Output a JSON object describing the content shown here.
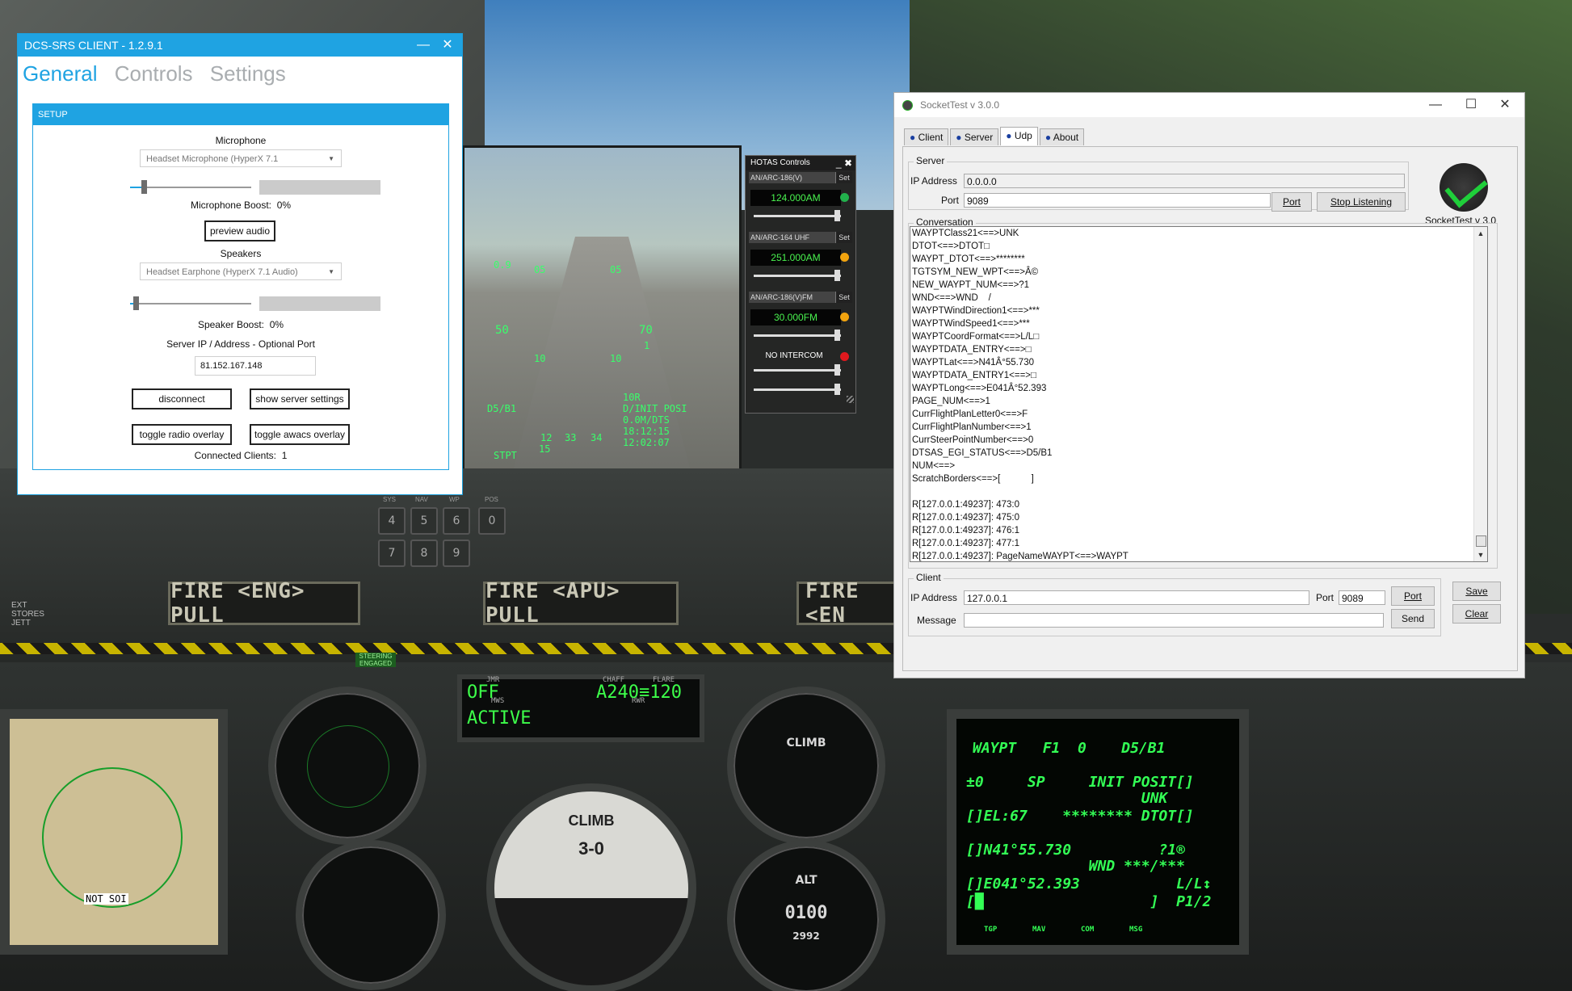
{
  "hud": {
    "left_scale": [
      "0.9",
      "50"
    ],
    "right_scale": [
      "70",
      "1"
    ],
    "ladder": [
      "05",
      "05",
      "10",
      "10"
    ],
    "waypoint": [
      "10R",
      "D/INIT POSI",
      "0.0M/DTS",
      "18:12:15",
      "12:02:07"
    ],
    "mode": "D5/B1",
    "bottom": "STPT",
    "range": [
      "12",
      "33",
      "34"
    ],
    "heading": "15"
  },
  "cockpit": {
    "fire_eng": "FIRE <ENG> PULL",
    "fire_apu": "FIRE <APU> PULL",
    "fire_eng_r": "FIRE <EN",
    "steering": "STEERING ENGAGED",
    "cmsp_l1": "OFF",
    "cmsp_l2": "ACTIVE",
    "cmsp_r": "A240≡120",
    "cmsp_jmr": "JMR",
    "cmsp_chaff": "CHAFF",
    "cmsp_flare": "FLARE",
    "cmsp_mws": "MWS",
    "cmsp_rwr": "RWR",
    "cdu_keys": [
      "4",
      "5",
      "6",
      "0",
      "7",
      "8",
      "9"
    ],
    "adi_label": "CLIMB",
    "adi_value": "3-0",
    "vvi_label": "CLIMB",
    "alt_value": "0100",
    "alt_label": "ALT",
    "alt_sub": "2992",
    "map_label": "NOT SOI",
    "ext_stores": "EXT STORES JETT",
    "cdu_label_a": "SYS",
    "cdu_label_b": "NAV",
    "cdu_label_c": "WP",
    "cdu_label_d": "POS",
    "mfd": {
      "r1": "WAYPT   F1  0    D5/B1",
      "r2": "±0     SP     INIT POSIT[]",
      "r3": "                    UNK",
      "r4": "[]EL:67    ******** DTOT[]",
      "r5": "[]N41°55.730          ?1®",
      "r6": "              WND ***/***",
      "r7": "[]E041°52.393           L/L↕",
      "r8": "[█                   ]  P1/2",
      "osb": [
        "TGP",
        "MAV",
        "COM",
        "MSG"
      ]
    }
  },
  "hotas": {
    "title": "HOTAS Controls",
    "minimize": "_",
    "close": "✖",
    "radios": [
      {
        "name": "AN/ARC-186(V)",
        "set": "Set",
        "freq": "124.000AM",
        "led": "#22b14c"
      },
      {
        "name": "AN/ARC-164 UHF",
        "set": "Set",
        "freq": "251.000AM",
        "led": "#f2a40f"
      },
      {
        "name": "AN/ARC-186(V)FM",
        "set": "Set",
        "freq": "30.000FM",
        "led": "#f2a40f"
      }
    ],
    "intercom": {
      "name": "NO INTERCOM",
      "led": "#e0191e"
    }
  },
  "srs": {
    "title": "DCS-SRS CLIENT - 1.2.9.1",
    "minimize": "—",
    "close": "✕",
    "tabs": [
      "General",
      "Controls",
      "Settings"
    ],
    "setup_header": "SETUP",
    "mic_label": "Microphone",
    "mic_device": "Headset Microphone (HyperX 7.1",
    "mic_boost_label": "Microphone Boost:",
    "mic_boost_value": "0%",
    "preview_button": "preview audio",
    "speakers_label": "Speakers",
    "speaker_device": "Headset Earphone (HyperX 7.1 Audio)",
    "speaker_boost_label": "Speaker Boost:",
    "speaker_boost_value": "0%",
    "server_label": "Server IP / Address - Optional Port",
    "server_value": "81.152.167.148",
    "disconnect_button": "disconnect",
    "show_settings_button": "show server settings",
    "radio_overlay_button": "toggle radio overlay",
    "awacs_overlay_button": "toggle awacs overlay",
    "connected_label": "Connected Clients:",
    "connected_value": "1"
  },
  "socket": {
    "title": "SocketTest v 3.0.0",
    "tabs": [
      "Client",
      "Server",
      "Udp",
      "About"
    ],
    "active_tab": "Udp",
    "server_group": "Server",
    "ip_label": "IP Address",
    "server_ip": "0.0.0.0",
    "port_label": "Port",
    "server_port": "9089",
    "port_button": "Port",
    "stop_button": "Stop Listening",
    "logo_caption": "SocketTest v 3.0",
    "conversation_group": "Conversation",
    "conversation": [
      "WAYPTClass21<==>UNK",
      "DTOT<==>DTOT□",
      "WAYPT_DTOT<==>********",
      "TGTSYM_NEW_WPT<==>Â©",
      "NEW_WAYPT_NUM<==>?1",
      "WND<==>WND    /",
      "WAYPTWindDirection1<==>***",
      "WAYPTWindSpeed1<==>***",
      "WAYPTCoordFormat<==>L/L□",
      "WAYPTDATA_ENTRY<==>□",
      "WAYPTLat<==>N41Â°55.730",
      "WAYPTDATA_ENTRY1<==>□",
      "WAYPTLong<==>E041Â°52.393",
      "PAGE_NUM<==>1",
      "CurrFlightPlanLetter0<==>F",
      "CurrFlightPlanNumber<==>1",
      "CurrSteerPointNumber<==>0",
      "DTSAS_EGI_STATUS<==>D5/B1",
      "NUM<==>",
      "ScratchBorders<==>[            ]",
      "",
      "R[127.0.0.1:49237]: 473:0",
      "R[127.0.0.1:49237]: 475:0",
      "R[127.0.0.1:49237]: 476:1",
      "R[127.0.0.1:49237]: 477:1",
      "R[127.0.0.1:49237]: PageNameWAYPT<==>WAYPT"
    ],
    "client_group": "Client",
    "client_ip": "127.0.0.1",
    "client_port": "9089",
    "message_label": "Message",
    "message_value": "",
    "client_port_button": "Port",
    "send_button": "Send",
    "save_button": "Save",
    "clear_button": "Clear"
  }
}
